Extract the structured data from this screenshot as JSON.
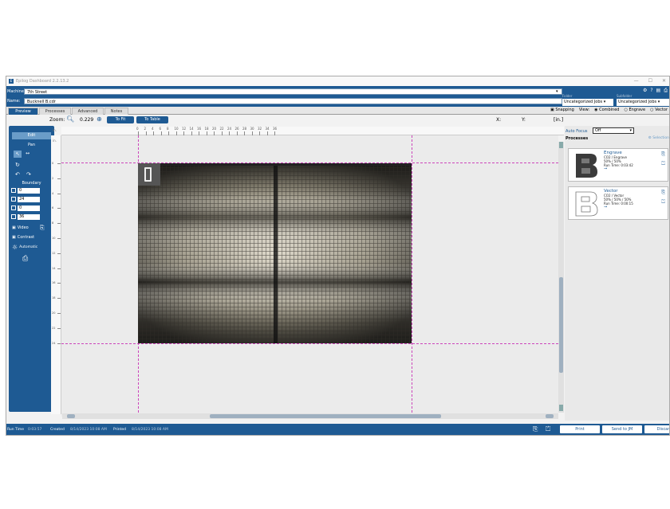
{
  "window": {
    "title": "Epilog Dashboard 2.2.13.2"
  },
  "header": {
    "machine_label": "Machine:",
    "machine_value": "7th Street",
    "name_label": "Name:",
    "name_value": "Bucknell B.cdr",
    "folder_label": "Folder",
    "folder_value": "Uncategorized Jobs",
    "subfolder_label": "Subfolder",
    "subfolder_value": "Uncategorized Jobs"
  },
  "tabs": [
    {
      "label": "Preview"
    },
    {
      "label": "Processes"
    },
    {
      "label": "Advanced"
    },
    {
      "label": "Notes"
    }
  ],
  "view_options": {
    "snapping": "Snapping",
    "view_label": "View:",
    "combined": "Combined",
    "engrave": "Engrave",
    "vector": "Vector"
  },
  "toolbar": {
    "zoom_label": "Zoom:",
    "zoom_value": "0.229",
    "to_fit": "To Fit",
    "to_table": "To Table",
    "x_label": "X:",
    "y_label": "Y:",
    "unit": "[in.]"
  },
  "left_panel": {
    "edit": "Edit",
    "pan": "Pan",
    "boundary": "Boundary",
    "boundary_values": [
      "0",
      "24",
      "0",
      "36"
    ],
    "video": "Video",
    "contrast": "Contrast",
    "automatic": "Automatic"
  },
  "ruler": {
    "unit_top": "in.",
    "unit_left": "in.",
    "top_ticks": [
      "0",
      "2",
      "4",
      "6",
      "8",
      "10",
      "12",
      "14",
      "16",
      "18",
      "20",
      "22",
      "24",
      "26",
      "28",
      "30",
      "32",
      "34",
      "36"
    ],
    "left_ticks": [
      "0",
      "2",
      "4",
      "6",
      "8",
      "10",
      "12",
      "14",
      "16",
      "18",
      "20",
      "22",
      "24"
    ]
  },
  "right_panel": {
    "auto_focus_label": "Auto Focus",
    "auto_focus_value": "Off",
    "processes_label": "Processes",
    "selection_label": "Selection",
    "processes": [
      {
        "title": "Engrave",
        "line1": "CO2 / Engrave",
        "line2": "50% / 50%",
        "line3": "Run Time: 0:03:42"
      },
      {
        "title": "Vector",
        "line1": "CO2 / Vector",
        "line2": "50% / 50% / 50%",
        "line3": "Run Time: 0:00:15"
      }
    ]
  },
  "statusbar": {
    "run_time_label": "Run Time",
    "run_time_value": "0:03:57",
    "created_label": "Created",
    "created_value": "8/14/2023 10:08 AM",
    "printed_label": "Printed",
    "printed_value": "8/14/2023 10:08 AM",
    "print_button": "Print",
    "send_button": "Send to JM",
    "discard_button": "Discard"
  },
  "colors": {
    "accent": "#1e5a93",
    "guide": "#cc44bb"
  }
}
